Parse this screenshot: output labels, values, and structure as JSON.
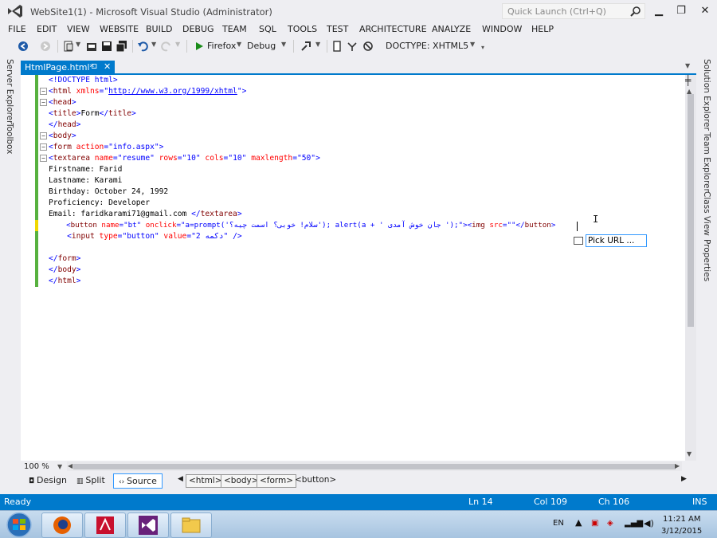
{
  "window": {
    "title": "WebSite1(1) - Microsoft Visual Studio (Administrator)",
    "quick_launch_placeholder": "Quick Launch (Ctrl+Q)"
  },
  "menu": [
    "FILE",
    "EDIT",
    "VIEW",
    "WEBSITE",
    "BUILD",
    "DEBUG",
    "TEAM",
    "SQL",
    "TOOLS",
    "TEST",
    "ARCHITECTURE",
    "ANALYZE",
    "WINDOW",
    "HELP"
  ],
  "toolbar": {
    "browser_label": "Firefox",
    "config_label": "Debug",
    "doctype_label": "DOCTYPE: XHTML5"
  },
  "left_tabs": [
    "Server Explorer",
    "Toolbox"
  ],
  "right_tabs": [
    "Solution Explorer",
    "Team Explorer",
    "Class View",
    "Properties"
  ],
  "doc_tab": {
    "label": "HtmlPage.html*",
    "pin": "⊐",
    "close": "✕"
  },
  "code": {
    "l1": {
      "a": "<!DOCTYPE html>"
    },
    "l2": {
      "a": "<",
      "b": "html",
      "c": " xmlns",
      "d": "=\"",
      "e": "http://www.w3.org/1999/xhtml",
      "f": "\">"
    },
    "l3": {
      "a": "<",
      "b": "head",
      "c": ">"
    },
    "l4": {
      "a": "<",
      "b": "title",
      "c": ">",
      "d": "Form",
      "e": "</",
      "f": "title",
      "g": ">"
    },
    "l5": {
      "a": "</",
      "b": "head",
      "c": ">"
    },
    "l6": {
      "a": "<",
      "b": "body",
      "c": ">"
    },
    "l7": {
      "a": "<",
      "b": "form",
      "c": " action",
      "d": "=\"info.aspx\">"
    },
    "l8": {
      "a": "<",
      "b": "textarea",
      "c": " name",
      "d": "=\"resume\"",
      "e": " rows",
      "f": "=\"10\"",
      "g": " cols",
      "h": "=\"10\"",
      "i": " maxlength",
      "j": "=\"50\">"
    },
    "l9": "Firstname: Farid",
    "l10": "Lastname: Karami",
    "l11": "Birthday: October 24, 1992",
    "l12": "Proficiency: Developer",
    "l13": {
      "a": "Email: faridkarami71@gmail.com ",
      "b": "</",
      "c": "textarea",
      "d": ">"
    },
    "l14": {
      "a": "    <",
      "b": "button",
      "c": " name",
      "d": "=\"bt\"",
      "e": " onclick",
      "f": "=\"a=prompt('سلام! خوبی؟ اسمت چیه؟'); alert(a + ' جان خوش آمدی ');\">",
      "g": "<",
      "h": "img",
      "i": " src",
      "j": "=\"\"",
      "k": "</",
      "l": "button",
      "m": ">"
    },
    "l15": {
      "a": "    <",
      "b": "input",
      "c": " type",
      "d": "=\"button\"",
      "e": " value",
      "f": "=\"2 دکمه\"",
      "g": " />"
    },
    "l17": {
      "a": "</",
      "b": "form",
      "c": ">"
    },
    "l18": {
      "a": "</",
      "b": "body",
      "c": ">"
    },
    "l19": {
      "a": "</",
      "b": "html",
      "c": ">"
    }
  },
  "intellisense": {
    "item": "Pick URL ..."
  },
  "editor_footer": {
    "zoom": "100 %"
  },
  "views": {
    "design": "Design",
    "split": "Split",
    "source": "Source"
  },
  "breadcrumbs": [
    "<html>",
    "<body>",
    "<form>",
    "<button>"
  ],
  "status": {
    "state": "Ready",
    "line": "Ln 14",
    "col": "Col 109",
    "ch": "Ch 106",
    "mode": "INS"
  },
  "tray": {
    "lang": "EN",
    "time": "11:21 AM",
    "date": "3/12/2015"
  },
  "colors": {
    "accent": "#007acc",
    "tag": "#800000",
    "attr": "#ff0000",
    "value": "#0000ff"
  }
}
